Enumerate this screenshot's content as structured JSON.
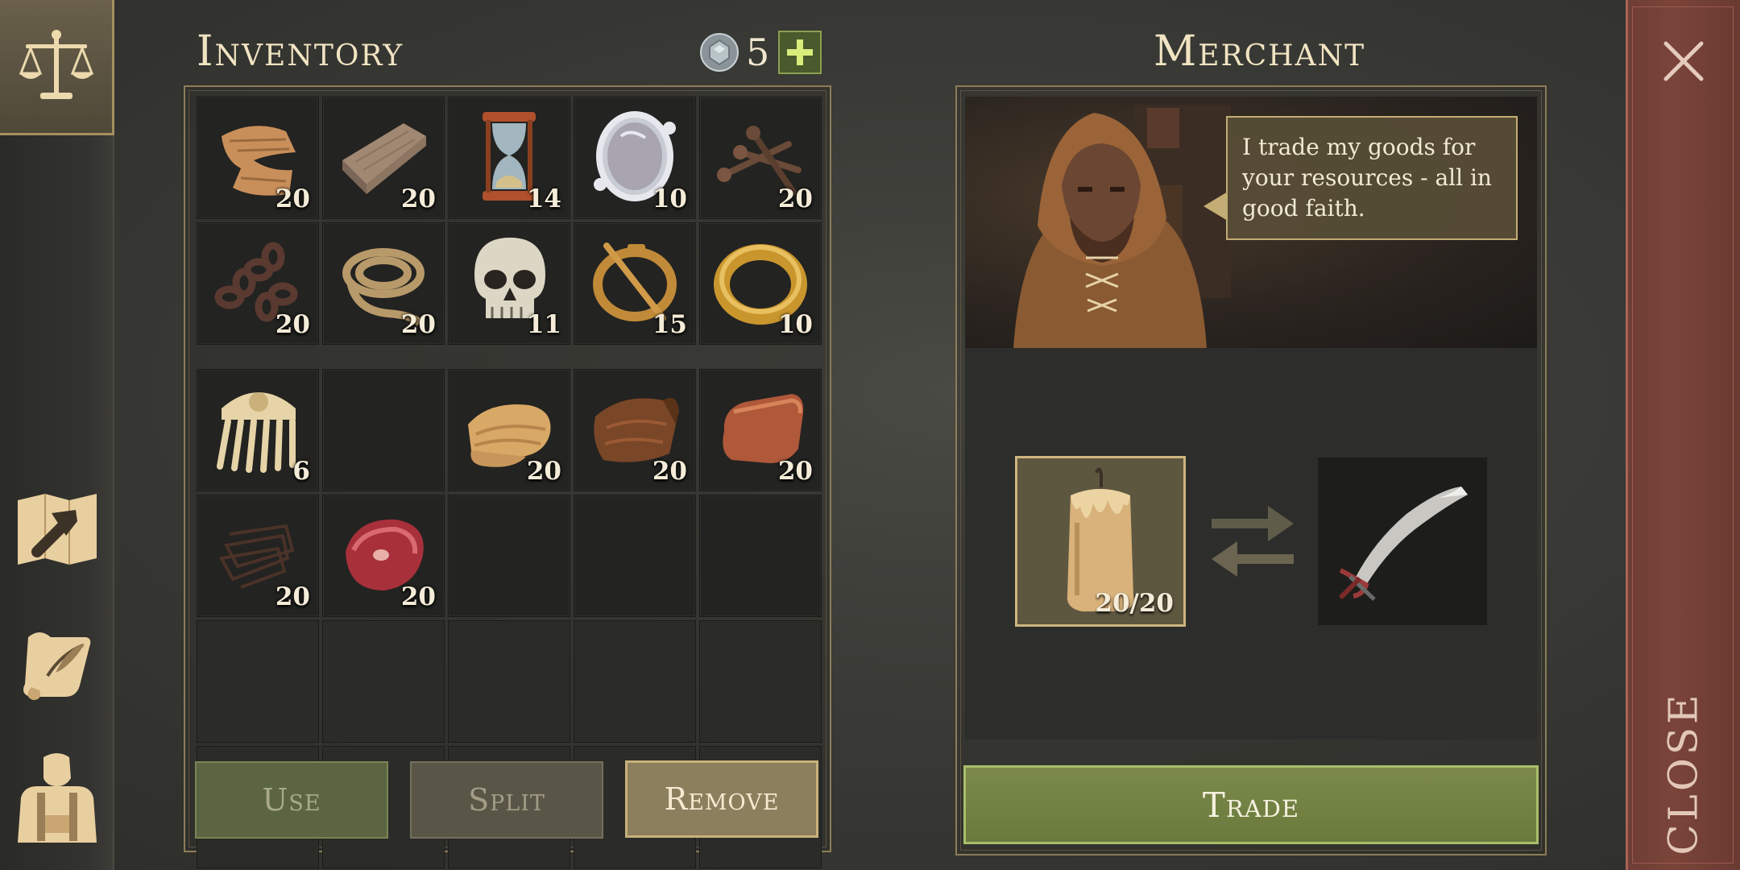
{
  "inventory": {
    "title": "Inventory",
    "currency_amount": "5",
    "currency_icon": "gem-coin-icon",
    "add_icon": "plus-icon",
    "items": [
      {
        "name": "cloth-scraps",
        "icon": "cloth-scraps-icon",
        "count": "20"
      },
      {
        "name": "wooden-plank",
        "icon": "wooden-plank-icon",
        "count": "20"
      },
      {
        "name": "hourglass",
        "icon": "hourglass-icon",
        "count": "14"
      },
      {
        "name": "silver-mirror",
        "icon": "mirror-icon",
        "count": "10"
      },
      {
        "name": "nails",
        "icon": "nails-icon",
        "count": "20"
      },
      {
        "name": "chain",
        "icon": "chain-icon",
        "count": "20"
      },
      {
        "name": "rope",
        "icon": "rope-icon",
        "count": "20"
      },
      {
        "name": "skull",
        "icon": "skull-icon",
        "count": "11"
      },
      {
        "name": "brooch",
        "icon": "brooch-icon",
        "count": "15"
      },
      {
        "name": "gold-ring",
        "icon": "ring-icon",
        "count": "10"
      },
      {
        "name": "ornate-comb",
        "icon": "comb-icon",
        "count": "6"
      },
      {
        "name": "empty",
        "icon": "",
        "count": ""
      },
      {
        "name": "linen-bolt",
        "icon": "linen-icon",
        "count": "20"
      },
      {
        "name": "leather",
        "icon": "leather-icon",
        "count": "20"
      },
      {
        "name": "copper-ingot",
        "icon": "copper-ingot-icon",
        "count": "20"
      },
      {
        "name": "wire",
        "icon": "wire-icon",
        "count": "20"
      },
      {
        "name": "raw-meat",
        "icon": "raw-meat-icon",
        "count": "20"
      }
    ],
    "buttons": {
      "use": "Use",
      "split": "Split",
      "remove": "Remove"
    }
  },
  "merchant": {
    "title": "Merchant",
    "speech": "I trade my goods for your resources - all in good faith.",
    "give_item": {
      "name": "candle",
      "icon": "candle-icon",
      "count": "20/20"
    },
    "receive_item": {
      "name": "scimitar",
      "icon": "scimitar-icon"
    },
    "exchange_icon": "exchange-arrows-icon",
    "trade_label": "Trade"
  },
  "close": {
    "label": "CLOSE",
    "icon": "close-x-icon"
  },
  "nav": {
    "items": [
      {
        "name": "trade",
        "icon": "scales-icon",
        "active": true
      },
      {
        "name": "crafting",
        "icon": "hammer-map-icon"
      },
      {
        "name": "quests",
        "icon": "scroll-quill-icon"
      },
      {
        "name": "character",
        "icon": "character-backpack-icon"
      }
    ]
  },
  "colors": {
    "accent_gold": "#c7b17a",
    "trade_green": "#6a7a3c",
    "close_red": "#7a443a"
  }
}
